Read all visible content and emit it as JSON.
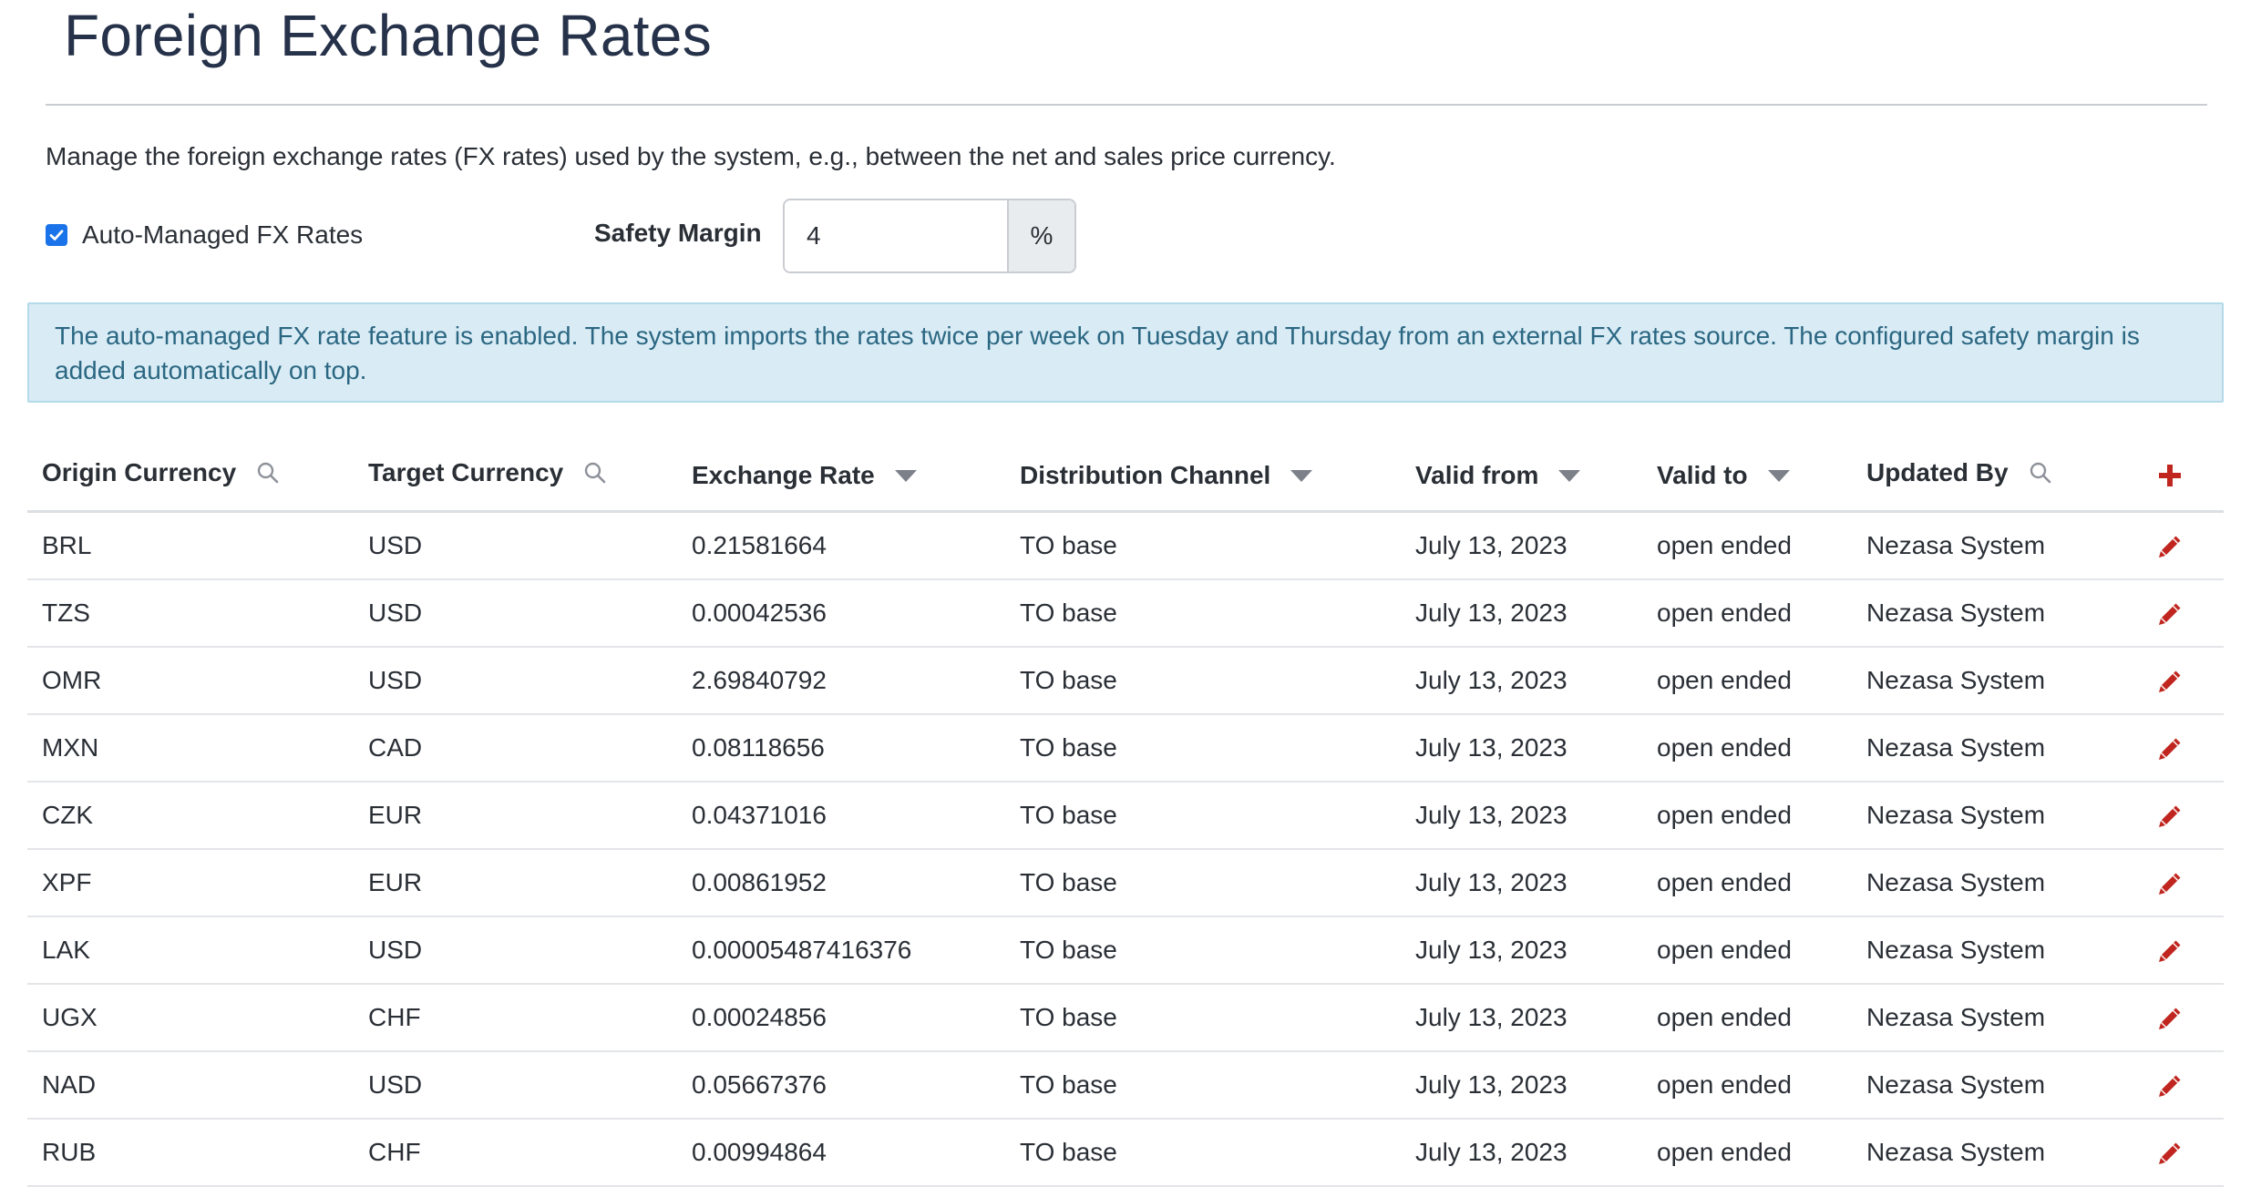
{
  "page": {
    "title": "Foreign Exchange Rates",
    "description": "Manage the foreign exchange rates (FX rates) used by the system, e.g., between the net and sales price currency."
  },
  "settings": {
    "auto_managed_label": "Auto-Managed FX Rates",
    "auto_managed_checked": true,
    "safety_margin_label": "Safety Margin",
    "safety_margin_value": "4",
    "safety_margin_unit": "%"
  },
  "alert": {
    "text": "The auto-managed FX rate feature is enabled. The system imports the rates twice per week on Tuesday and Thursday from an external FX rates source. The configured safety margin is added automatically on top."
  },
  "table": {
    "columns": [
      {
        "label": "Origin Currency",
        "control": "search-icon"
      },
      {
        "label": "Target Currency",
        "control": "search-icon"
      },
      {
        "label": "Exchange Rate",
        "control": "sort-caret-icon"
      },
      {
        "label": "Distribution Channel",
        "control": "sort-caret-icon"
      },
      {
        "label": "Valid from",
        "control": "sort-caret-icon"
      },
      {
        "label": "Valid to",
        "control": "sort-caret-icon"
      },
      {
        "label": "Updated By",
        "control": "search-icon"
      }
    ],
    "rows": [
      {
        "origin": "BRL",
        "target": "USD",
        "rate": "0.21581664",
        "channel": "TO base",
        "valid_from": "July 13, 2023",
        "valid_to": "open ended",
        "updated_by": "Nezasa System"
      },
      {
        "origin": "TZS",
        "target": "USD",
        "rate": "0.00042536",
        "channel": "TO base",
        "valid_from": "July 13, 2023",
        "valid_to": "open ended",
        "updated_by": "Nezasa System"
      },
      {
        "origin": "OMR",
        "target": "USD",
        "rate": "2.69840792",
        "channel": "TO base",
        "valid_from": "July 13, 2023",
        "valid_to": "open ended",
        "updated_by": "Nezasa System"
      },
      {
        "origin": "MXN",
        "target": "CAD",
        "rate": "0.08118656",
        "channel": "TO base",
        "valid_from": "July 13, 2023",
        "valid_to": "open ended",
        "updated_by": "Nezasa System"
      },
      {
        "origin": "CZK",
        "target": "EUR",
        "rate": "0.04371016",
        "channel": "TO base",
        "valid_from": "July 13, 2023",
        "valid_to": "open ended",
        "updated_by": "Nezasa System"
      },
      {
        "origin": "XPF",
        "target": "EUR",
        "rate": "0.00861952",
        "channel": "TO base",
        "valid_from": "July 13, 2023",
        "valid_to": "open ended",
        "updated_by": "Nezasa System"
      },
      {
        "origin": "LAK",
        "target": "USD",
        "rate": "0.00005487416376",
        "channel": "TO base",
        "valid_from": "July 13, 2023",
        "valid_to": "open ended",
        "updated_by": "Nezasa System"
      },
      {
        "origin": "UGX",
        "target": "CHF",
        "rate": "0.00024856",
        "channel": "TO base",
        "valid_from": "July 13, 2023",
        "valid_to": "open ended",
        "updated_by": "Nezasa System"
      },
      {
        "origin": "NAD",
        "target": "USD",
        "rate": "0.05667376",
        "channel": "TO base",
        "valid_from": "July 13, 2023",
        "valid_to": "open ended",
        "updated_by": "Nezasa System"
      },
      {
        "origin": "RUB",
        "target": "CHF",
        "rate": "0.00994864",
        "channel": "TO base",
        "valid_from": "July 13, 2023",
        "valid_to": "open ended",
        "updated_by": "Nezasa System"
      }
    ],
    "row_action_icon": "pencil-icon",
    "add_action_icon": "plus-icon"
  },
  "colors": {
    "title": "#26324a",
    "accent_red": "#c0261f",
    "checkbox_blue": "#1a73e8",
    "alert_bg": "#d9ecf5",
    "alert_text": "#2b6782"
  }
}
